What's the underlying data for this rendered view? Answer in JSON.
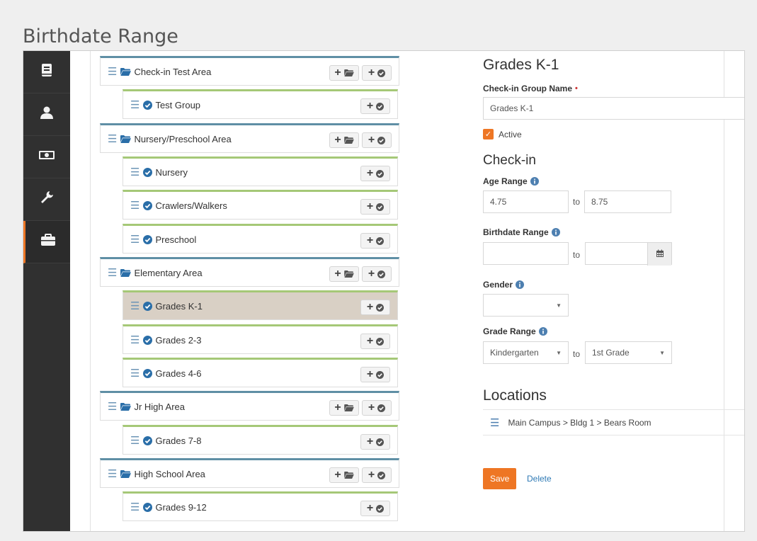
{
  "page": {
    "heading": "Birthdate Range"
  },
  "sidebar": {
    "items": [
      {
        "icon": "book-icon"
      },
      {
        "icon": "user-icon"
      },
      {
        "icon": "money-icon"
      },
      {
        "icon": "wrench-icon"
      },
      {
        "icon": "briefcase-icon",
        "active": true
      }
    ]
  },
  "tree": {
    "add_button_symbol": "+",
    "items": [
      {
        "label": "Check-in Test Area",
        "type": "area"
      },
      {
        "label": "Test Group",
        "type": "group"
      },
      {
        "label": "Nursery/Preschool Area",
        "type": "area"
      },
      {
        "label": "Nursery",
        "type": "group"
      },
      {
        "label": "Crawlers/Walkers",
        "type": "group"
      },
      {
        "label": "Preschool",
        "type": "group"
      },
      {
        "label": "Elementary Area",
        "type": "area"
      },
      {
        "label": "Grades K-1",
        "type": "group",
        "selected": true
      },
      {
        "label": "Grades 2-3",
        "type": "group"
      },
      {
        "label": "Grades 4-6",
        "type": "group"
      },
      {
        "label": "Jr High Area",
        "type": "area"
      },
      {
        "label": "Grades 7-8",
        "type": "group"
      },
      {
        "label": "High School Area",
        "type": "area"
      },
      {
        "label": "Grades 9-12",
        "type": "group"
      }
    ]
  },
  "detail": {
    "title": "Grades K-1",
    "group_name_label": "Check-in Group Name",
    "required_marker": "•",
    "group_name_value": "Grades K-1",
    "active_label": "Active",
    "checkin_heading": "Check-in",
    "age_range_label": "Age Range",
    "age_min": "4.75",
    "age_max": "8.75",
    "to_text": "to",
    "birthdate_range_label": "Birthdate Range",
    "birthdate_from": "",
    "birthdate_to": "",
    "gender_label": "Gender",
    "gender_value": "",
    "grade_range_label": "Grade Range",
    "grade_from": "Kindergarten",
    "grade_to": "1st Grade",
    "locations_heading": "Locations",
    "location_path": "Main Campus > Bldg 1 > Bears Room",
    "remove_symbol": "×",
    "add_symbol": "+",
    "save_label": "Save",
    "delete_label": "Delete"
  },
  "colors": {
    "accent": "#ee7624",
    "sidebar_bg": "#303030",
    "area_border": "#5f8fa5",
    "group_border": "#a5c877",
    "selected_row": "#d9d0c5",
    "link": "#2f7ab5",
    "danger": "#c9302c"
  }
}
